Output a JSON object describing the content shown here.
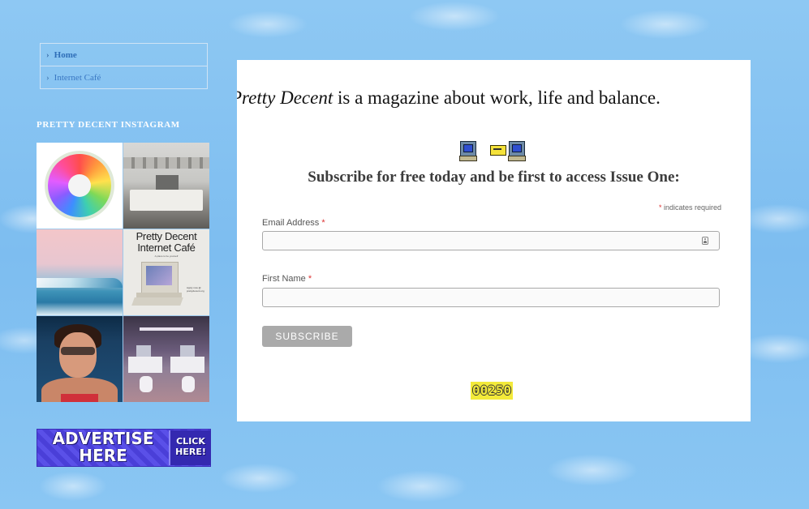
{
  "sidebar": {
    "nav": [
      {
        "label": "Home"
      },
      {
        "label": "Internet Café"
      }
    ],
    "instagram_heading": "PRETTY DECENT INSTAGRAM",
    "instagram_tiles": [
      {
        "caption": ""
      },
      {
        "caption": ""
      },
      {
        "caption": ""
      },
      {
        "caption": "Pretty Decent Internet Café",
        "subcaption": "A place to be yourself",
        "apply": "Apply now @ prettydecent.org"
      },
      {
        "caption": ""
      },
      {
        "caption": ""
      }
    ],
    "ad": {
      "main": "ADVERTISE HERE",
      "click": "CLICK HERE!"
    }
  },
  "main": {
    "tagline": {
      "italic": "Pretty Decent",
      "rest": " is a magazine about work, life and balance."
    },
    "icons": [
      "computer-icon",
      "envelope-icon",
      "computer-icon"
    ],
    "subscribe_heading": "Subscribe for free today and be first to access Issue One:",
    "required_note": {
      "asterisk": "*",
      "text": " indicates required"
    },
    "fields": {
      "email": {
        "label": "Email Address ",
        "asterisk": "*",
        "value": "",
        "placeholder": ""
      },
      "first_name": {
        "label": "First Name ",
        "asterisk": "*",
        "value": "",
        "placeholder": ""
      }
    },
    "subscribe_button": "SUBSCRIBE",
    "visitor_counter": "00250"
  }
}
